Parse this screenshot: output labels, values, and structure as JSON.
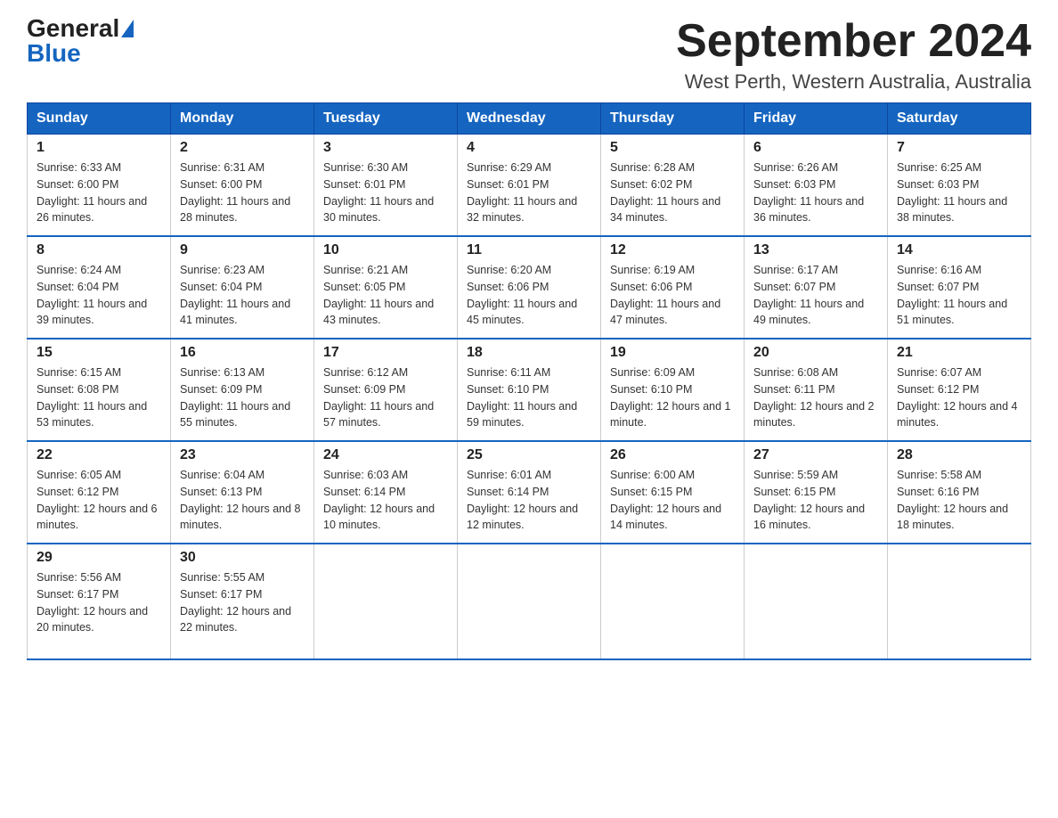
{
  "header": {
    "logo_general": "General",
    "logo_blue": "Blue",
    "month_title": "September 2024",
    "location": "West Perth, Western Australia, Australia"
  },
  "weekdays": [
    "Sunday",
    "Monday",
    "Tuesday",
    "Wednesday",
    "Thursday",
    "Friday",
    "Saturday"
  ],
  "weeks": [
    [
      {
        "day": "1",
        "sunrise": "6:33 AM",
        "sunset": "6:00 PM",
        "daylight": "11 hours and 26 minutes."
      },
      {
        "day": "2",
        "sunrise": "6:31 AM",
        "sunset": "6:00 PM",
        "daylight": "11 hours and 28 minutes."
      },
      {
        "day": "3",
        "sunrise": "6:30 AM",
        "sunset": "6:01 PM",
        "daylight": "11 hours and 30 minutes."
      },
      {
        "day": "4",
        "sunrise": "6:29 AM",
        "sunset": "6:01 PM",
        "daylight": "11 hours and 32 minutes."
      },
      {
        "day": "5",
        "sunrise": "6:28 AM",
        "sunset": "6:02 PM",
        "daylight": "11 hours and 34 minutes."
      },
      {
        "day": "6",
        "sunrise": "6:26 AM",
        "sunset": "6:03 PM",
        "daylight": "11 hours and 36 minutes."
      },
      {
        "day": "7",
        "sunrise": "6:25 AM",
        "sunset": "6:03 PM",
        "daylight": "11 hours and 38 minutes."
      }
    ],
    [
      {
        "day": "8",
        "sunrise": "6:24 AM",
        "sunset": "6:04 PM",
        "daylight": "11 hours and 39 minutes."
      },
      {
        "day": "9",
        "sunrise": "6:23 AM",
        "sunset": "6:04 PM",
        "daylight": "11 hours and 41 minutes."
      },
      {
        "day": "10",
        "sunrise": "6:21 AM",
        "sunset": "6:05 PM",
        "daylight": "11 hours and 43 minutes."
      },
      {
        "day": "11",
        "sunrise": "6:20 AM",
        "sunset": "6:06 PM",
        "daylight": "11 hours and 45 minutes."
      },
      {
        "day": "12",
        "sunrise": "6:19 AM",
        "sunset": "6:06 PM",
        "daylight": "11 hours and 47 minutes."
      },
      {
        "day": "13",
        "sunrise": "6:17 AM",
        "sunset": "6:07 PM",
        "daylight": "11 hours and 49 minutes."
      },
      {
        "day": "14",
        "sunrise": "6:16 AM",
        "sunset": "6:07 PM",
        "daylight": "11 hours and 51 minutes."
      }
    ],
    [
      {
        "day": "15",
        "sunrise": "6:15 AM",
        "sunset": "6:08 PM",
        "daylight": "11 hours and 53 minutes."
      },
      {
        "day": "16",
        "sunrise": "6:13 AM",
        "sunset": "6:09 PM",
        "daylight": "11 hours and 55 minutes."
      },
      {
        "day": "17",
        "sunrise": "6:12 AM",
        "sunset": "6:09 PM",
        "daylight": "11 hours and 57 minutes."
      },
      {
        "day": "18",
        "sunrise": "6:11 AM",
        "sunset": "6:10 PM",
        "daylight": "11 hours and 59 minutes."
      },
      {
        "day": "19",
        "sunrise": "6:09 AM",
        "sunset": "6:10 PM",
        "daylight": "12 hours and 1 minute."
      },
      {
        "day": "20",
        "sunrise": "6:08 AM",
        "sunset": "6:11 PM",
        "daylight": "12 hours and 2 minutes."
      },
      {
        "day": "21",
        "sunrise": "6:07 AM",
        "sunset": "6:12 PM",
        "daylight": "12 hours and 4 minutes."
      }
    ],
    [
      {
        "day": "22",
        "sunrise": "6:05 AM",
        "sunset": "6:12 PM",
        "daylight": "12 hours and 6 minutes."
      },
      {
        "day": "23",
        "sunrise": "6:04 AM",
        "sunset": "6:13 PM",
        "daylight": "12 hours and 8 minutes."
      },
      {
        "day": "24",
        "sunrise": "6:03 AM",
        "sunset": "6:14 PM",
        "daylight": "12 hours and 10 minutes."
      },
      {
        "day": "25",
        "sunrise": "6:01 AM",
        "sunset": "6:14 PM",
        "daylight": "12 hours and 12 minutes."
      },
      {
        "day": "26",
        "sunrise": "6:00 AM",
        "sunset": "6:15 PM",
        "daylight": "12 hours and 14 minutes."
      },
      {
        "day": "27",
        "sunrise": "5:59 AM",
        "sunset": "6:15 PM",
        "daylight": "12 hours and 16 minutes."
      },
      {
        "day": "28",
        "sunrise": "5:58 AM",
        "sunset": "6:16 PM",
        "daylight": "12 hours and 18 minutes."
      }
    ],
    [
      {
        "day": "29",
        "sunrise": "5:56 AM",
        "sunset": "6:17 PM",
        "daylight": "12 hours and 20 minutes."
      },
      {
        "day": "30",
        "sunrise": "5:55 AM",
        "sunset": "6:17 PM",
        "daylight": "12 hours and 22 minutes."
      },
      null,
      null,
      null,
      null,
      null
    ]
  ]
}
